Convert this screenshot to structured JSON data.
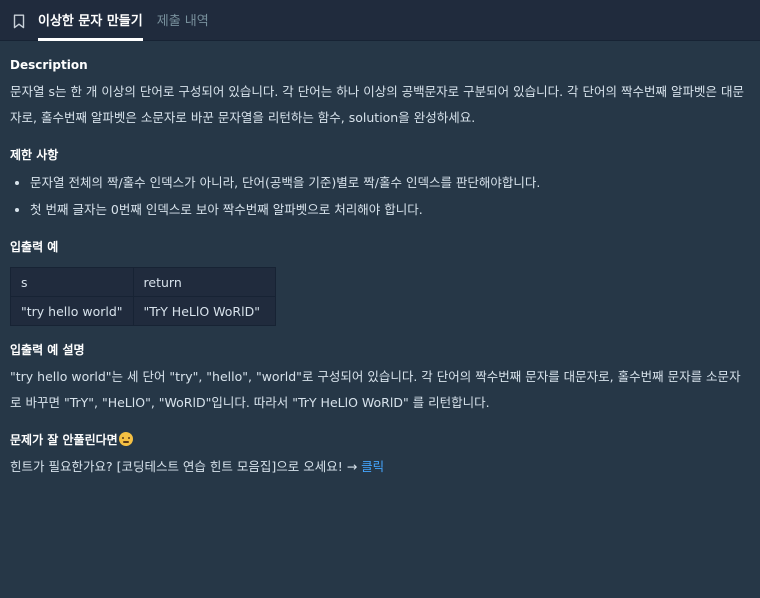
{
  "tabs": [
    {
      "label": "이상한 문자 만들기",
      "active": true
    },
    {
      "label": "제출 내역",
      "active": false
    }
  ],
  "description": {
    "heading": "Description",
    "text": "문자열 s는 한 개 이상의 단어로 구성되어 있습니다. 각 단어는 하나 이상의 공백문자로 구분되어 있습니다. 각 단어의 짝수번째 알파벳은 대문자로, 홀수번째 알파벳은 소문자로 바꾼 문자열을 리턴하는 함수, solution을 완성하세요."
  },
  "constraints": {
    "heading": "제한 사항",
    "items": [
      "문자열 전체의 짝/홀수 인덱스가 아니라, 단어(공백을 기준)별로 짝/홀수 인덱스를 판단해야합니다.",
      "첫 번째 글자는 0번째 인덱스로 보아 짝수번째 알파벳으로 처리해야 합니다."
    ]
  },
  "io_example": {
    "heading": "입출력 예",
    "columns": [
      "s",
      "return"
    ],
    "rows": [
      [
        "\"try hello world\"",
        "\"TrY HeLlO WoRlD\""
      ]
    ]
  },
  "io_explanation": {
    "heading": "입출력 예 설명",
    "text": "\"try hello world\"는 세 단어 \"try\", \"hello\", \"world\"로 구성되어 있습니다. 각 단어의 짝수번째 문자를 대문자로, 홀수번째 문자를 소문자로 바꾸면 \"TrY\", \"HeLlO\", \"WoRlD\"입니다. 따라서 \"TrY HeLlO WoRlD\" 를 리턴합니다."
  },
  "hint": {
    "heading": "문제가 잘 안풀린다면",
    "text": "힌트가 필요한가요? [코딩테스트 연습 힌트 모음집]으로 오세요! → ",
    "link": "클릭"
  },
  "colors": {
    "background": "#263747",
    "tab_bar": "#202b3d",
    "link": "#44a4fc"
  },
  "icons": [
    "bookmark-icon",
    "disappointed-face-emoji"
  ]
}
